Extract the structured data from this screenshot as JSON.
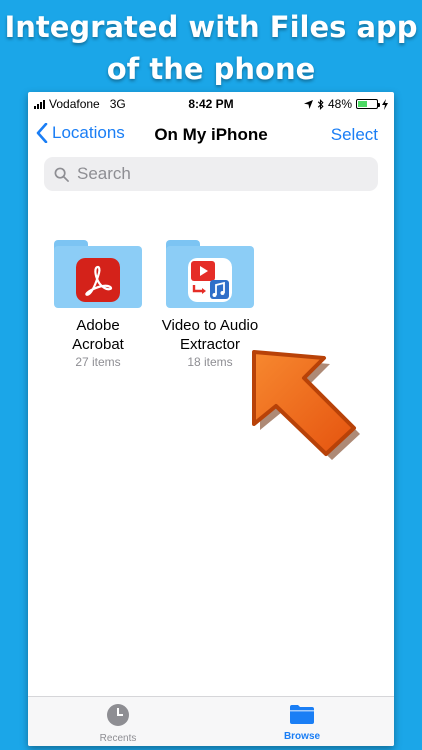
{
  "promo": {
    "headline_line1": "Integrated with Files app",
    "headline_line2": "of the phone"
  },
  "status_bar": {
    "carrier": "Vodafone",
    "network": "3G",
    "time": "8:42 PM",
    "battery_percent": "48%",
    "battery_level": 0.48
  },
  "nav": {
    "back_label": "Locations",
    "title": "On My iPhone",
    "select_label": "Select"
  },
  "search": {
    "placeholder": "Search"
  },
  "folders": [
    {
      "name_line1": "Adobe",
      "name_line2": "Acrobat",
      "count": "27 items",
      "icon": "adobe-acrobat-icon"
    },
    {
      "name_line1": "Video to Audio",
      "name_line2": "Extractor",
      "count": "18 items",
      "icon": "video-to-audio-app-icon"
    }
  ],
  "tabbar": {
    "recents_label": "Recents",
    "browse_label": "Browse",
    "active_color": "#1a7ef5",
    "inactive_color": "#8e8e93"
  },
  "colors": {
    "background": "#1ba6e8",
    "accent": "#1a7ef5",
    "arrow": "#f46b1c"
  }
}
